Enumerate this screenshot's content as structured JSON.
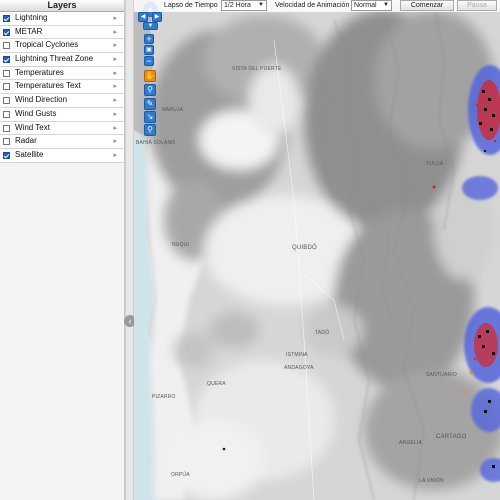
{
  "layers_panel": {
    "title": "Layers",
    "items": [
      {
        "label": "Lightning",
        "checked": true
      },
      {
        "label": "METAR",
        "checked": true
      },
      {
        "label": "Tropical Cyclones",
        "checked": false
      },
      {
        "label": "Lightning Threat Zone",
        "checked": true
      },
      {
        "label": "Temperatures",
        "checked": false
      },
      {
        "label": "Temperatures Text",
        "checked": false
      },
      {
        "label": "Wind Direction",
        "checked": false
      },
      {
        "label": "Wind Gusts",
        "checked": false
      },
      {
        "label": "Wind Text",
        "checked": false
      },
      {
        "label": "Radar",
        "checked": false
      },
      {
        "label": "Satellite",
        "checked": true
      }
    ]
  },
  "toolbar": {
    "time_span_label": "Lapso de Tiempo",
    "time_span_value": "1/2 Hora",
    "speed_label": "Velocidad de Animación",
    "speed_value": "Normal",
    "start_button": "Comenzar",
    "pause_button": "Pausa"
  },
  "map_labels": {
    "vista_del_puerte": "VISTA DEL PUERTE",
    "naruja": "NARUJA",
    "bahia_solano": "BAHIA SOLANO",
    "quibdo": "QUIBDÓ",
    "nuqui": "NUQUI",
    "tado": "TADÓ",
    "istmina": "ISTMINA",
    "andagoya": "ANDAGOYA",
    "pizarro": "PIZARRO",
    "quera": "QUERA",
    "orpua": "ORPÚA",
    "cartago": "CARTAGO",
    "la_union": "LA UNIÓN",
    "argelia": "ARGELIA",
    "santuario": "SANTUARIO",
    "tuluá": "TULUÁ"
  },
  "colors": {
    "accent": "#2e7bd1",
    "check": "#1c5fd0",
    "ocean": "#cfe3ea",
    "storm_core": "#111111",
    "storm_red": "#e0201a",
    "threat_zone": "#5566dd"
  }
}
